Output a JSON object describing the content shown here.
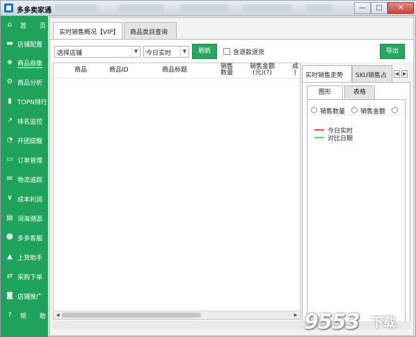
{
  "window": {
    "title": "多多卖家通",
    "controls": {
      "minimize": "—",
      "maximize": "□",
      "close": "✕"
    }
  },
  "sidebar": {
    "items": [
      {
        "icon": "home-icon",
        "glyph": "⌂",
        "label": "首 页"
      },
      {
        "icon": "cart-icon",
        "glyph": "▬",
        "label": "店铺配置"
      },
      {
        "icon": "cube-icon",
        "glyph": "◈",
        "label": "商品画像"
      },
      {
        "icon": "analytics-icon",
        "glyph": "⚙",
        "label": "商品分析"
      },
      {
        "icon": "bar-chart-icon",
        "glyph": "▮",
        "label": "TOPN排行"
      },
      {
        "icon": "trend-icon",
        "glyph": "↗",
        "label": "排名监控"
      },
      {
        "icon": "bell-icon",
        "glyph": "◔",
        "label": "开团提醒"
      },
      {
        "icon": "folder-icon",
        "glyph": "▭",
        "label": "订单管理"
      },
      {
        "icon": "mail-icon",
        "glyph": "✉",
        "label": "物流追踪"
      },
      {
        "icon": "yen-icon",
        "glyph": "¥",
        "label": "成本利润"
      },
      {
        "icon": "book-icon",
        "glyph": "▤",
        "label": "词海溯源"
      },
      {
        "icon": "people-icon",
        "glyph": "☻",
        "label": "多多客服"
      },
      {
        "icon": "road-icon",
        "glyph": "▲",
        "label": "上货助手"
      },
      {
        "icon": "exchange-icon",
        "glyph": "⇄",
        "label": "采购下单"
      },
      {
        "icon": "car-icon",
        "glyph": "◙",
        "label": "店铺推广"
      },
      {
        "icon": "help-icon",
        "glyph": "?",
        "label": "帮 助"
      }
    ],
    "active_index": 2
  },
  "tabs": [
    "实时销售概况【VIP】",
    "商品类目查询"
  ],
  "toolbar": {
    "shop_select": "选择店铺",
    "time_select": "今日实时",
    "refresh_label": "刷新",
    "checkbox_label": "含退款退货",
    "export_label": "导出"
  },
  "grid": {
    "columns": [
      "商品",
      "商品ID",
      "商品标题",
      "销售\n数量",
      "销售金额\n(元)(?)",
      "成\n("
    ]
  },
  "right_panel": {
    "tabs": [
      "实时销售走势",
      "SKU销售占"
    ],
    "subtabs": [
      "图形",
      "表格"
    ],
    "radios": [
      "销售数量",
      "销售金额"
    ],
    "legend": [
      {
        "label": "今日实时",
        "color": "#e74c3c"
      },
      {
        "label": "对比日期",
        "color": "#4cd964"
      }
    ]
  },
  "watermark": {
    "text": "9553",
    "suffix": "下载"
  }
}
